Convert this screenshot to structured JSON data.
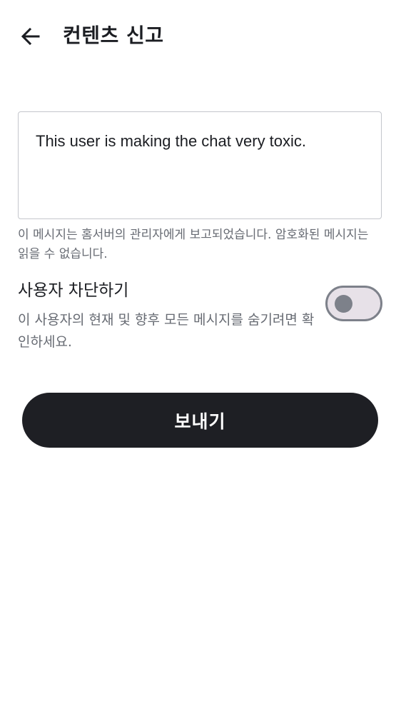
{
  "header": {
    "back_icon": "arrow-left-icon",
    "title": "컨텐츠 신고"
  },
  "report": {
    "reason_value": "This user is making the chat very toxic.",
    "helper_text": "이 메시지는 홈서버의 관리자에게 보고되었습니다. 암호화된 메시지는 읽을 수 없습니다."
  },
  "block_user": {
    "title": "사용자 차단하기",
    "description": "이 사용자의 현재 및 향후 모든 메시지를 숨기려면 확인하세요.",
    "enabled": false
  },
  "actions": {
    "send_label": "보내기"
  },
  "colors": {
    "primary_button": "#1e1f24",
    "secondary_text": "#676b73",
    "switch_track": "#e7e1e8",
    "switch_outline": "#7d818a"
  }
}
